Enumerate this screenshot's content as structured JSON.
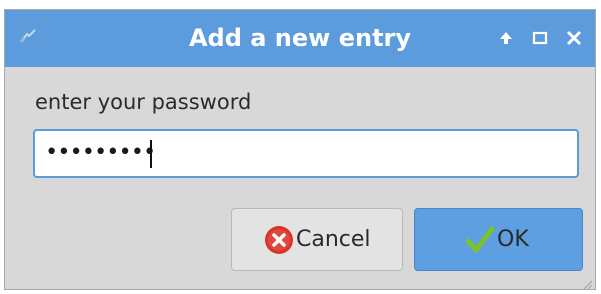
{
  "window": {
    "title": "Add a new entry",
    "icons": {
      "app": "app-icon",
      "keep_above": "arrow-up-icon",
      "maximize": "maximize-icon",
      "close": "close-icon"
    }
  },
  "prompt": {
    "label": "enter your password"
  },
  "password_field": {
    "value": "•••••••••"
  },
  "buttons": {
    "cancel": {
      "label": "Cancel",
      "icon": "cancel-circle-icon"
    },
    "ok": {
      "label": "OK",
      "icon": "checkmark-icon"
    }
  },
  "colors": {
    "titlebar": "#5c9bdc",
    "ok_button": "#5d9fe0",
    "cancel_icon": "#d9342b",
    "check_icon": "#7cc22a",
    "dialog_bg": "#d8d8d8"
  }
}
